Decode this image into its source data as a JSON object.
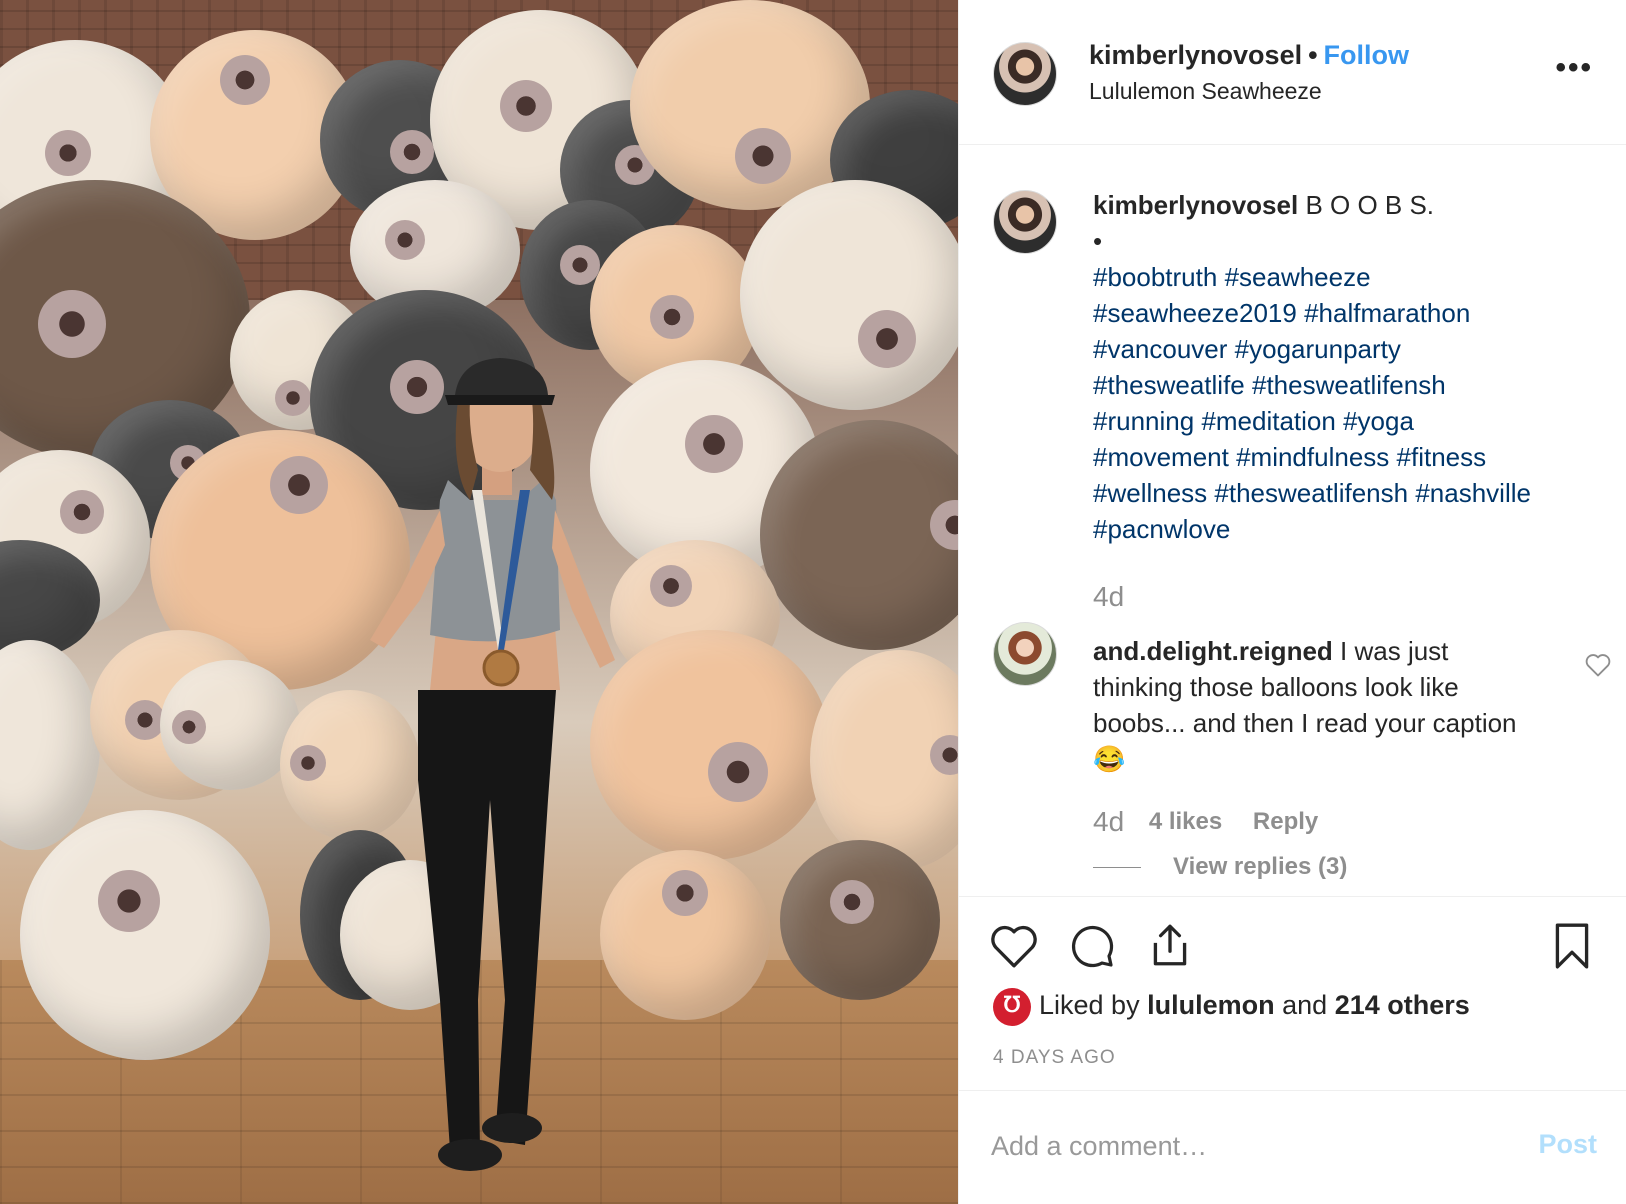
{
  "header": {
    "username": "kimberlynovosel",
    "separator": "•",
    "follow_label": "Follow",
    "location": "Lululemon Seawheeze",
    "more_icon": "more-dots-icon"
  },
  "caption": {
    "username": "kimberlynovosel",
    "text": "B O O B S.",
    "bullet": "•",
    "hashtags": [
      "#boobtruth",
      "#seawheeze",
      "#seawheeze2019",
      "#halfmarathon",
      "#vancouver",
      "#yogarunparty",
      "#thesweatlife",
      "#thesweatlifensh",
      "#running",
      "#meditation",
      "#yoga",
      "#movement",
      "#mindfulness",
      "#fitness",
      "#wellness",
      "#thesweatlifensh",
      "#nashville",
      "#pacnwlove"
    ],
    "age": "4d"
  },
  "comment": {
    "username": "and.delight.reigned",
    "text": "I was just thinking those balloons look like boobs... and then I read your caption 😂",
    "age": "4d",
    "likes": "4 likes",
    "reply_label": "Reply",
    "view_replies": "View replies (3)"
  },
  "actions": {
    "like_icon": "heart-icon",
    "comment_icon": "comment-bubble-icon",
    "share_icon": "share-icon",
    "save_icon": "bookmark-icon"
  },
  "likes": {
    "prefix": "Liked by",
    "user": "lululemon",
    "middle": "and",
    "others": "214 others",
    "brand_badge_color": "#d31f2f"
  },
  "timestamp": "4 DAYS AGO",
  "add_comment": {
    "placeholder": "Add a comment…",
    "post_label": "Post"
  },
  "colors": {
    "accent": "#3897f0",
    "hashtag": "#003569",
    "muted": "#8e8e8e",
    "post_disabled": "#b2dffc"
  }
}
